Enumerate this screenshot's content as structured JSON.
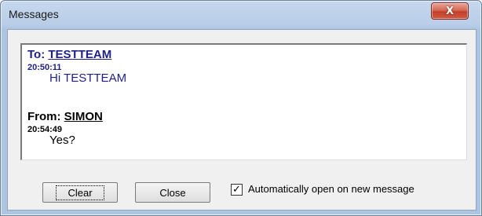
{
  "window": {
    "title": "Messages",
    "close_glyph": "X",
    "close_icon": "close-icon"
  },
  "messages": [
    {
      "direction_label": "To:",
      "name": "TESTTEAM",
      "time": "20:50:11",
      "text": "Hi TESTTEAM",
      "color": "#1f1f8a"
    },
    {
      "direction_label": "From:",
      "name": "SIMON",
      "time": "20:54:49",
      "text": "Yes?",
      "color": "#000000"
    }
  ],
  "buttons": {
    "clear_label": "Clear",
    "close_label": "Close"
  },
  "auto_open": {
    "checked": true,
    "check_glyph": "✓",
    "label": "Automatically open on new message"
  }
}
